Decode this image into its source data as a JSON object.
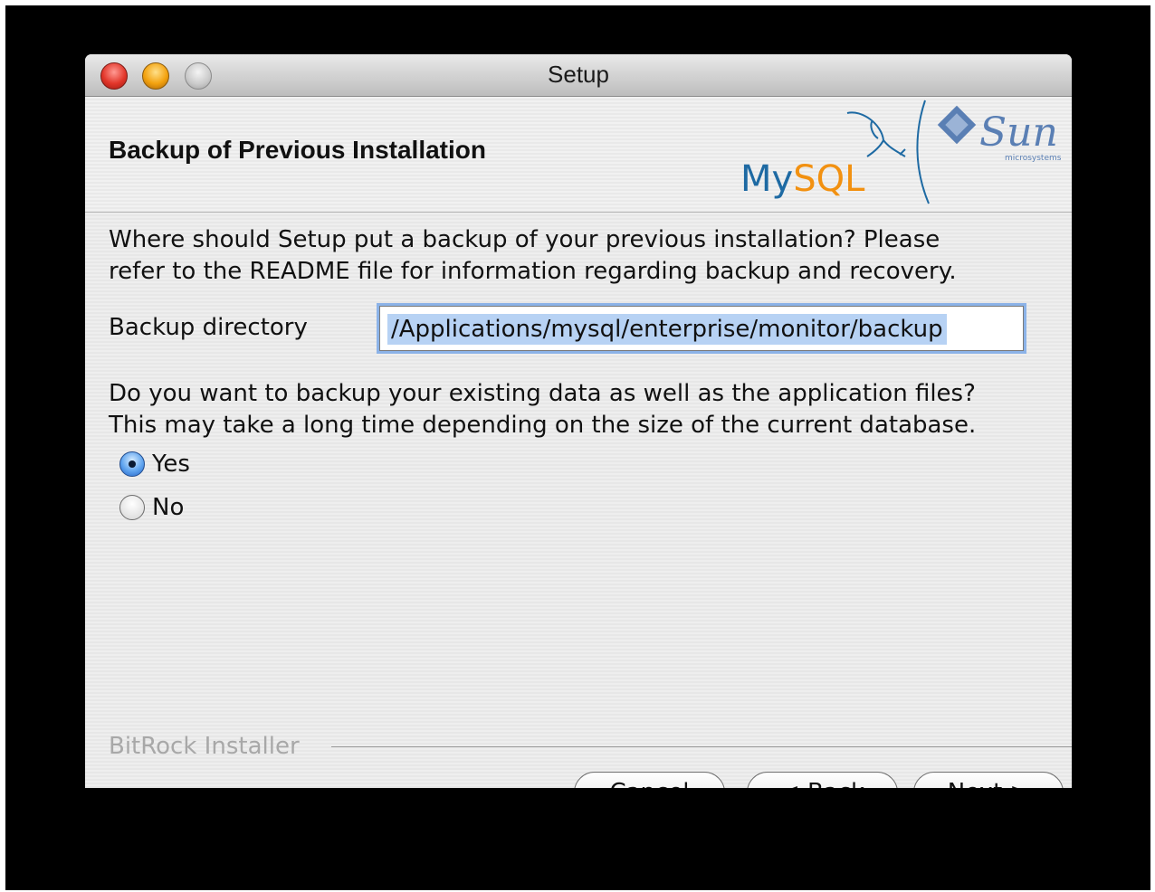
{
  "window": {
    "title": "Setup"
  },
  "header": {
    "title": "Backup of Previous Installation",
    "logo_mysql": "MySQL",
    "logo_sun": "Sun",
    "logo_sun_sub": "microsystems"
  },
  "content": {
    "intro_line1": "Where should Setup put a backup of your previous installation?  Please",
    "intro_line2": "refer to the README file for information regarding backup and recovery.",
    "dir_label": "Backup directory",
    "dir_value": "/Applications/mysql/enterprise/monitor/backup",
    "question_line1": "Do you want to backup your existing data as well as the application files?",
    "question_line2": "This may take a long time depending on the size of the current database.",
    "options": [
      {
        "label": "Yes",
        "selected": true
      },
      {
        "label": "No",
        "selected": false
      }
    ]
  },
  "footer": {
    "brand": "BitRock Installer",
    "cancel_label": "Cancel",
    "back_label": "< Back",
    "next_label": "Next >"
  },
  "colors": {
    "mysql_blue": "#1e6aa3",
    "mysql_orange": "#f29111",
    "sun_blue": "#5a7fb4",
    "focus_ring": "#8cb3e8",
    "selection": "#b7d2f4"
  }
}
